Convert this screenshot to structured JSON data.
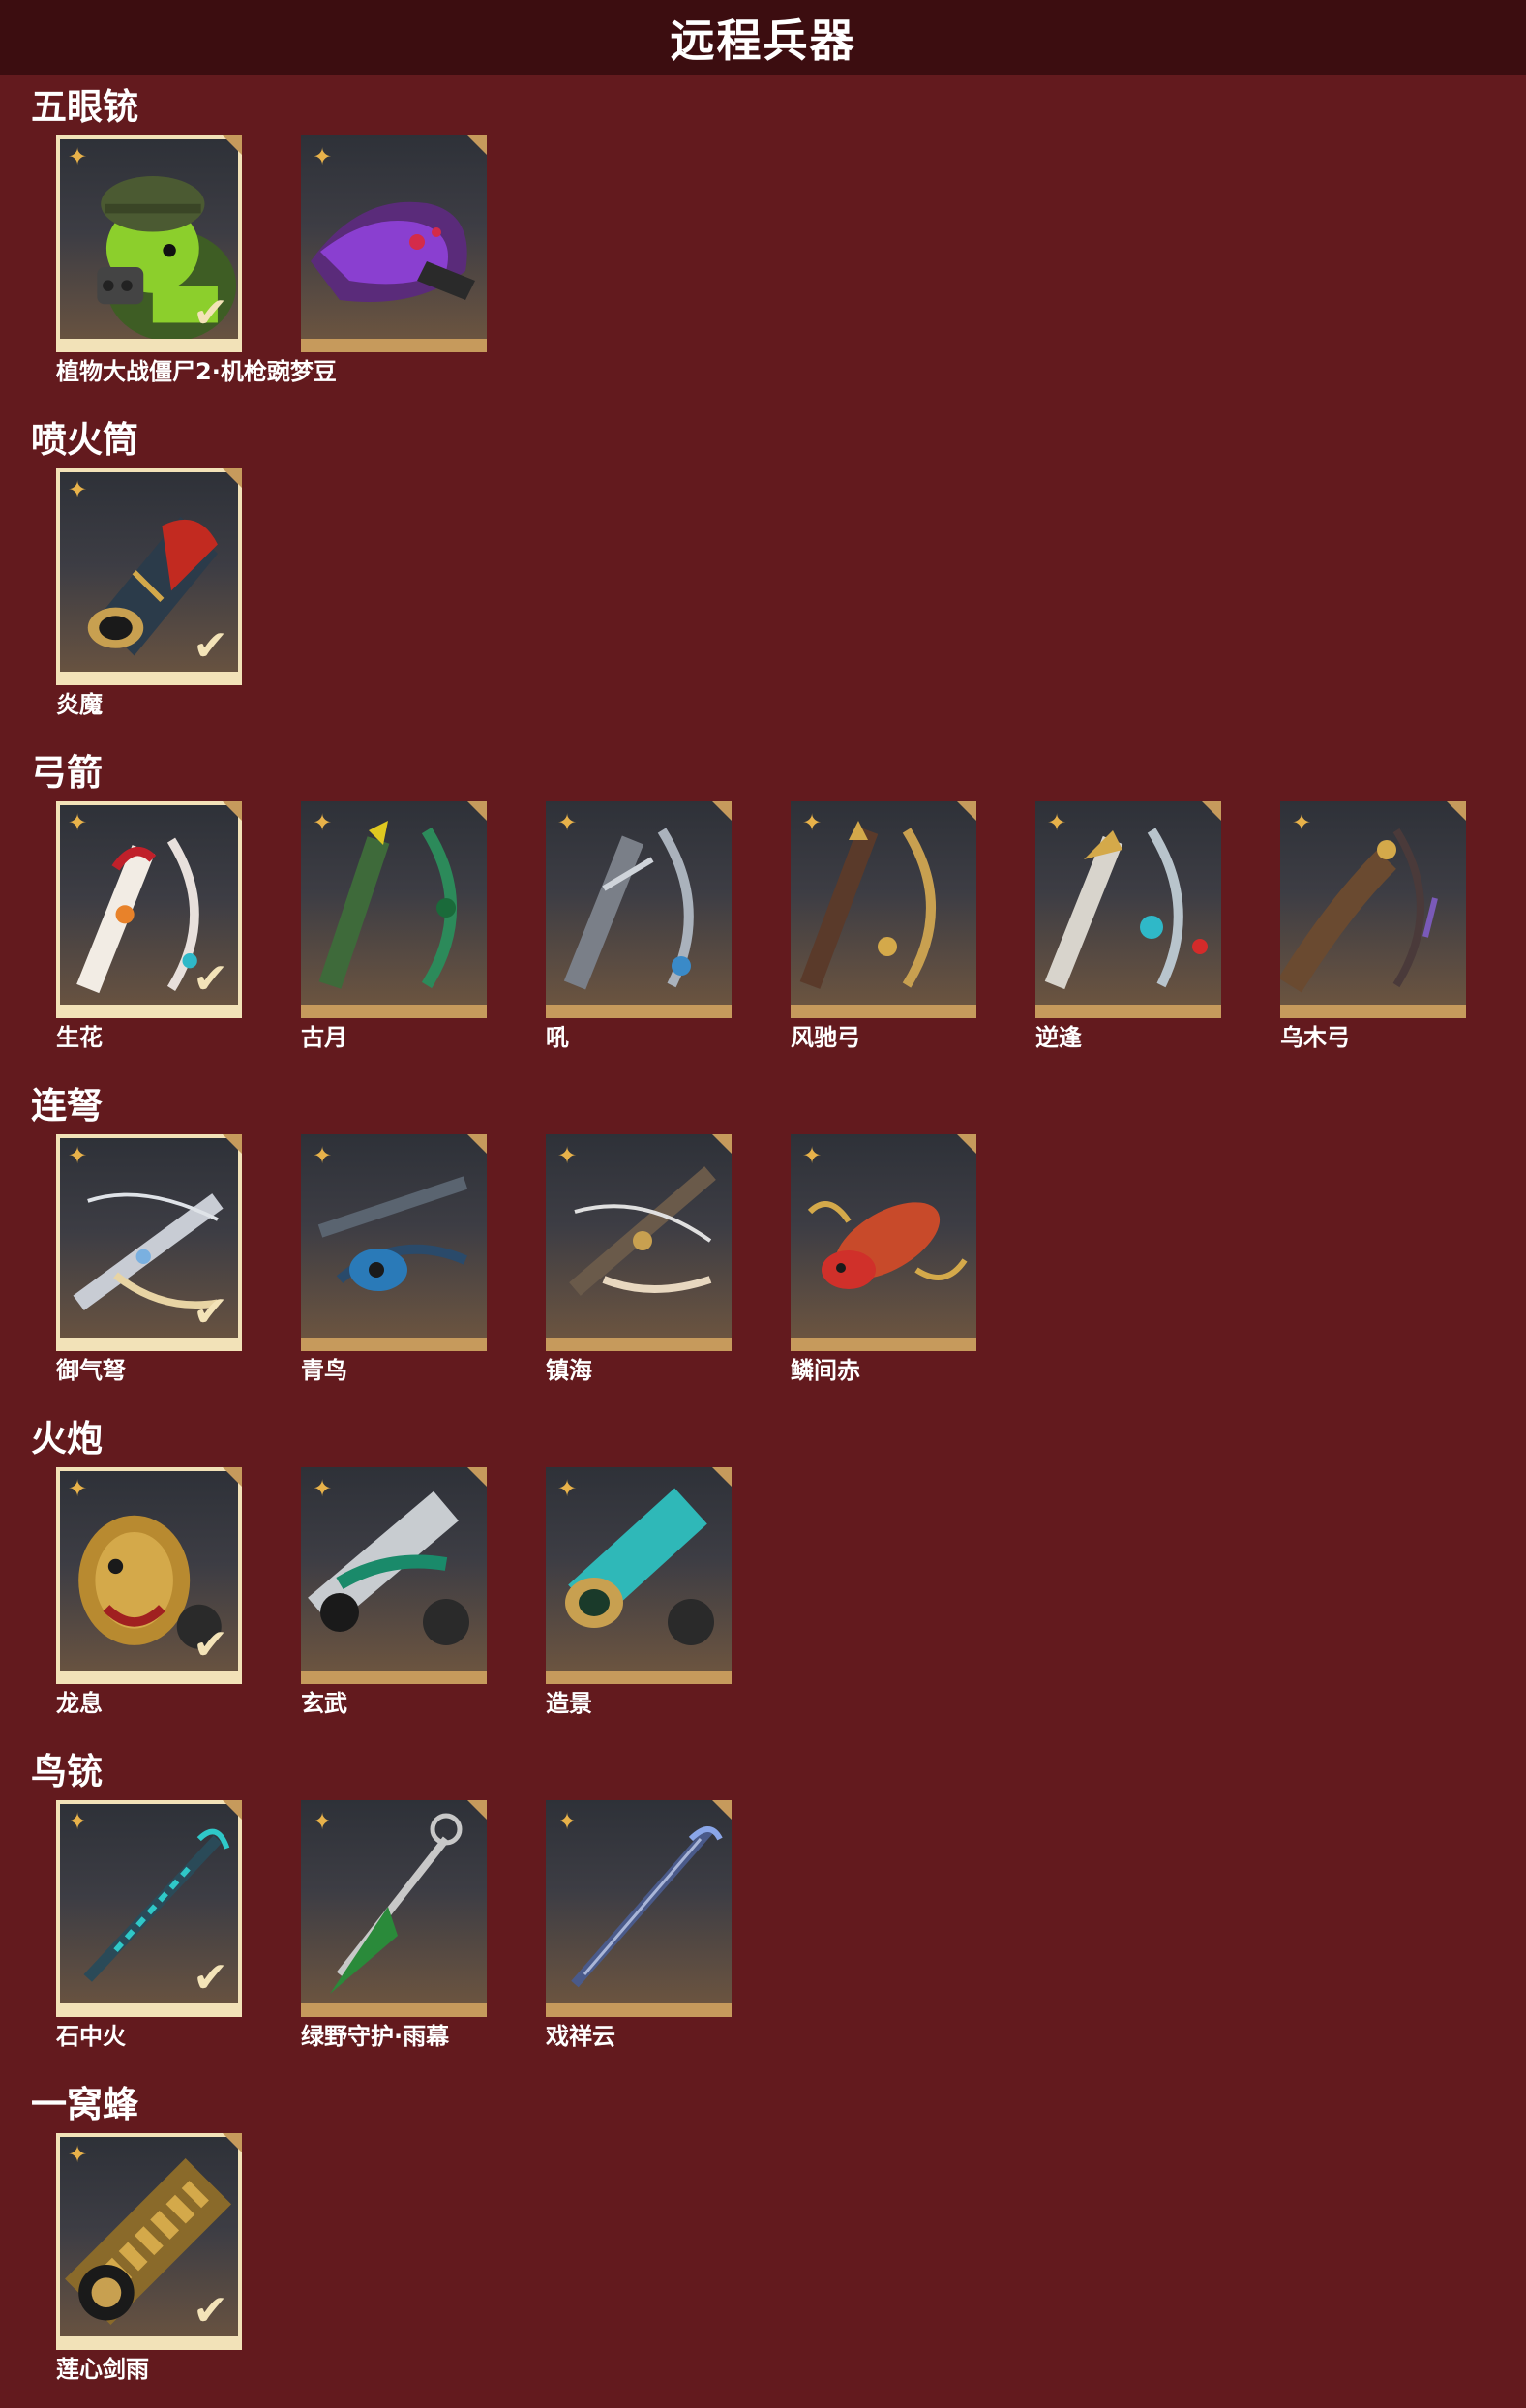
{
  "title": "远程兵器",
  "colors": {
    "background": "#631a1e",
    "titlebar": "#3c0d10",
    "card_frame": "#c69a5c",
    "selected_frame": "#f2e2b8",
    "star": "#e8b24a"
  },
  "sections": [
    {
      "name": "五眼铳",
      "items": [
        {
          "label": "植物大战僵尸2·机枪豌梦豆",
          "selected": true,
          "art": "peashooter"
        },
        {
          "label": "",
          "selected": false,
          "art": "purple-beast"
        }
      ]
    },
    {
      "name": "喷火筒",
      "items": [
        {
          "label": "炎魔",
          "selected": true,
          "art": "flame-tube"
        }
      ]
    },
    {
      "name": "弓箭",
      "items": [
        {
          "label": "生花",
          "selected": true,
          "art": "bow-red"
        },
        {
          "label": "古月",
          "selected": false,
          "art": "bow-green"
        },
        {
          "label": "吼",
          "selected": false,
          "art": "bow-silver"
        },
        {
          "label": "风驰弓",
          "selected": false,
          "art": "bow-gold"
        },
        {
          "label": "逆逢",
          "selected": false,
          "art": "bow-blue"
        },
        {
          "label": "乌木弓",
          "selected": false,
          "art": "bow-wood"
        }
      ]
    },
    {
      "name": "连弩",
      "items": [
        {
          "label": "御气弩",
          "selected": true,
          "art": "xbow-white"
        },
        {
          "label": "青鸟",
          "selected": false,
          "art": "xbow-blue"
        },
        {
          "label": "镇海",
          "selected": false,
          "art": "xbow-bronze"
        },
        {
          "label": "鳞间赤",
          "selected": false,
          "art": "xbow-fish"
        }
      ]
    },
    {
      "name": "火炮",
      "items": [
        {
          "label": "龙息",
          "selected": true,
          "art": "cannon-dragon"
        },
        {
          "label": "玄武",
          "selected": false,
          "art": "cannon-jade"
        },
        {
          "label": "造景",
          "selected": false,
          "art": "cannon-teal"
        }
      ]
    },
    {
      "name": "鸟铳",
      "items": [
        {
          "label": "石中火",
          "selected": true,
          "art": "musket-cyan"
        },
        {
          "label": "绿野守护·雨幕",
          "selected": false,
          "art": "musket-green"
        },
        {
          "label": "戏祥云",
          "selected": false,
          "art": "musket-blue"
        }
      ]
    },
    {
      "name": "一窝蜂",
      "items": [
        {
          "label": "莲心剑雨",
          "selected": true,
          "art": "hive-gold"
        }
      ]
    }
  ]
}
